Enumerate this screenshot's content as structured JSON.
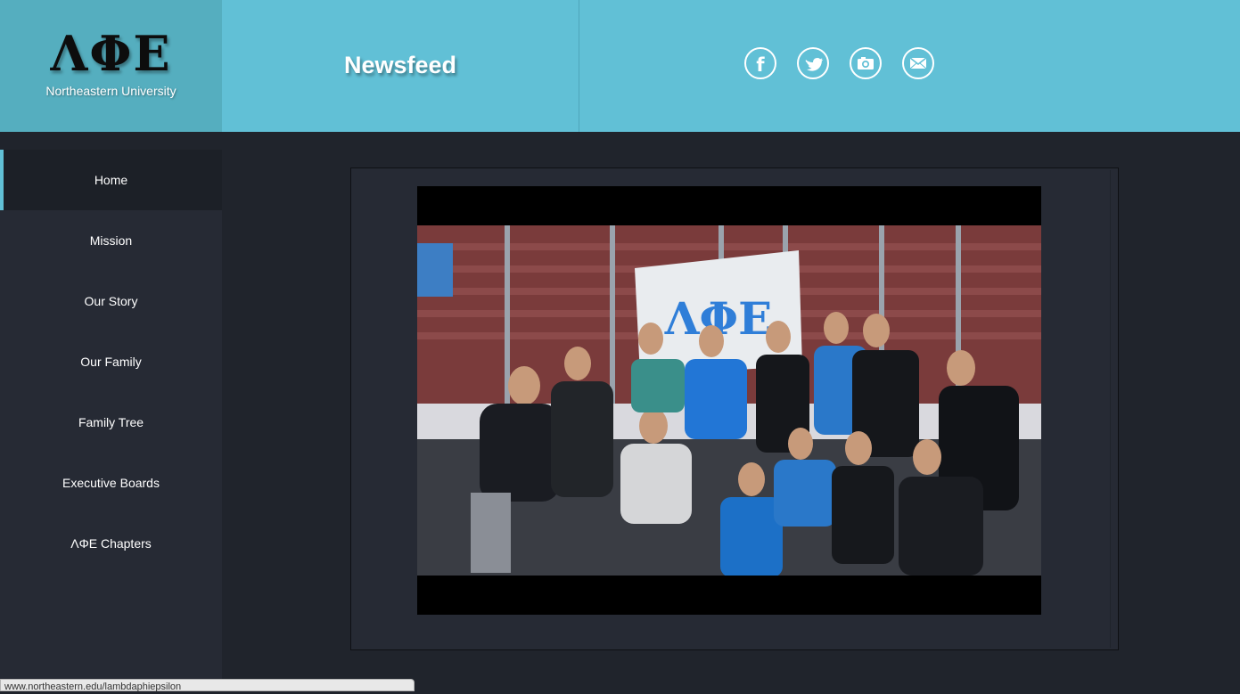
{
  "logo": {
    "letters": "ΛΦΕ",
    "subtitle": "Northeastern University"
  },
  "header": {
    "title": "Newsfeed"
  },
  "social": [
    {
      "name": "facebook-icon"
    },
    {
      "name": "twitter-icon"
    },
    {
      "name": "camera-icon"
    },
    {
      "name": "mail-icon"
    }
  ],
  "nav": {
    "items": [
      {
        "label": "Home",
        "active": true
      },
      {
        "label": "Mission"
      },
      {
        "label": "Our Story"
      },
      {
        "label": "Our Family"
      },
      {
        "label": "Family Tree"
      },
      {
        "label": "Executive Boards"
      },
      {
        "label": "ΛΦΕ Chapters"
      }
    ]
  },
  "video": {
    "banner_letters": "ΛΦΕ"
  },
  "status": {
    "url": "www.northeastern.edu/lambdaphiepsilon"
  },
  "colors": {
    "header": "#61c0d6",
    "logo_bg": "#55aebf",
    "sidebar": "#262a34",
    "background": "#20242c",
    "accent": "#61c0d6"
  }
}
